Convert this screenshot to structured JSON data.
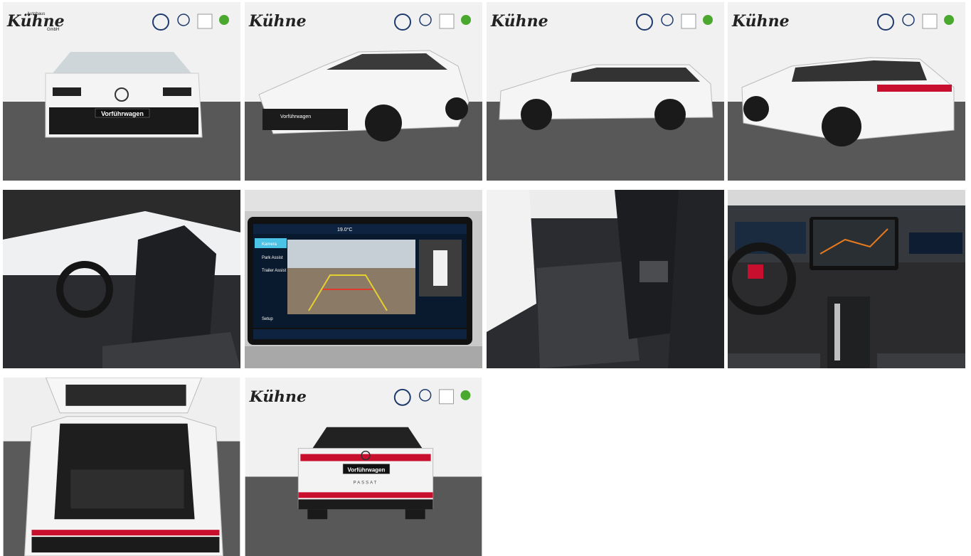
{
  "dealer": {
    "brand_top": "Autohaus",
    "brand_name": "Kühne",
    "brand_sub": "GmbH"
  },
  "plate_text": "Vorführwagen",
  "tailgate_text": "PASSAT",
  "brand_icons": [
    "vw-logo-icon",
    "vw-commercial-logo-icon",
    "audi-service-logo-icon",
    "skoda-logo-icon"
  ],
  "screen": {
    "menu_items": [
      "Kamera",
      "Park Assist",
      "Trailer Assist"
    ],
    "bottom_label": "Setup",
    "temperature": "19.0°C"
  },
  "colors": {
    "studio_wall": "#eeeeee",
    "studio_floor": "#555555",
    "car_white": "#f5f5f5",
    "tail_red": "#c8102e"
  }
}
